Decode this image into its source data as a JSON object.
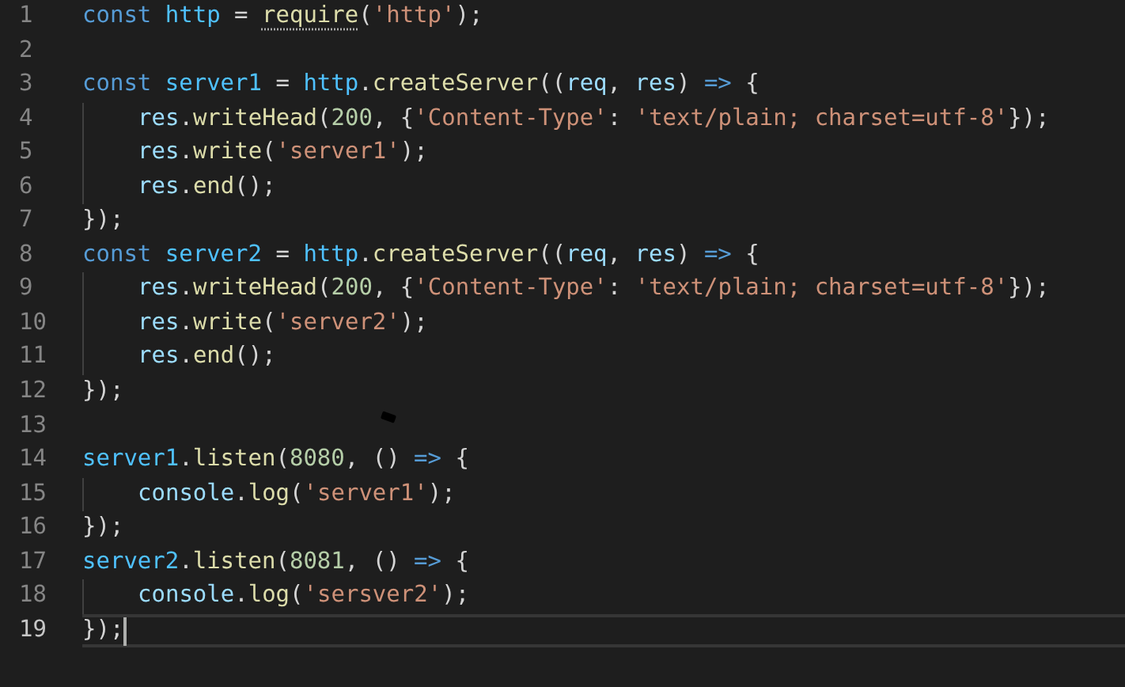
{
  "editor": {
    "lines": [
      {
        "number": "1",
        "current": false,
        "indented": false,
        "tokens": [
          {
            "kind": "keyword",
            "text": "const "
          },
          {
            "kind": "constant",
            "text": "http"
          },
          {
            "kind": "plain",
            "text": " = "
          },
          {
            "kind": "function",
            "text": "require",
            "hint": true
          },
          {
            "kind": "plain",
            "text": "("
          },
          {
            "kind": "string",
            "text": "'http'"
          },
          {
            "kind": "plain",
            "text": ");"
          }
        ]
      },
      {
        "number": "2",
        "current": false,
        "indented": false
      },
      {
        "number": "3",
        "current": false,
        "indented": false,
        "tokens": [
          {
            "kind": "keyword",
            "text": "const "
          },
          {
            "kind": "constant",
            "text": "server1"
          },
          {
            "kind": "plain",
            "text": " = "
          },
          {
            "kind": "constant",
            "text": "http"
          },
          {
            "kind": "plain",
            "text": "."
          },
          {
            "kind": "function",
            "text": "createServer"
          },
          {
            "kind": "plain",
            "text": "(("
          },
          {
            "kind": "variable",
            "text": "req"
          },
          {
            "kind": "plain",
            "text": ", "
          },
          {
            "kind": "variable",
            "text": "res"
          },
          {
            "kind": "plain",
            "text": ") "
          },
          {
            "kind": "keyword",
            "text": "=>"
          },
          {
            "kind": "plain",
            "text": " {"
          }
        ]
      },
      {
        "number": "4",
        "current": false,
        "indented": true,
        "tokens": [
          {
            "kind": "variable",
            "text": "res"
          },
          {
            "kind": "plain",
            "text": "."
          },
          {
            "kind": "function",
            "text": "writeHead"
          },
          {
            "kind": "plain",
            "text": "("
          },
          {
            "kind": "number",
            "text": "200"
          },
          {
            "kind": "plain",
            "text": ", {"
          },
          {
            "kind": "string",
            "text": "'Content-Type'"
          },
          {
            "kind": "plain",
            "text": ": "
          },
          {
            "kind": "string",
            "text": "'text/plain; charset=utf-8'"
          },
          {
            "kind": "plain",
            "text": "});"
          }
        ]
      },
      {
        "number": "5",
        "current": false,
        "indented": true,
        "tokens": [
          {
            "kind": "variable",
            "text": "res"
          },
          {
            "kind": "plain",
            "text": "."
          },
          {
            "kind": "function",
            "text": "write"
          },
          {
            "kind": "plain",
            "text": "("
          },
          {
            "kind": "string",
            "text": "'server1'"
          },
          {
            "kind": "plain",
            "text": ");"
          }
        ]
      },
      {
        "number": "6",
        "current": false,
        "indented": true,
        "tokens": [
          {
            "kind": "variable",
            "text": "res"
          },
          {
            "kind": "plain",
            "text": "."
          },
          {
            "kind": "function",
            "text": "end"
          },
          {
            "kind": "plain",
            "text": "();"
          }
        ]
      },
      {
        "number": "7",
        "current": false,
        "indented": false,
        "tokens": [
          {
            "kind": "plain",
            "text": "});"
          }
        ]
      },
      {
        "number": "8",
        "current": false,
        "indented": false,
        "tokens": [
          {
            "kind": "keyword",
            "text": "const "
          },
          {
            "kind": "constant",
            "text": "server2"
          },
          {
            "kind": "plain",
            "text": " = "
          },
          {
            "kind": "constant",
            "text": "http"
          },
          {
            "kind": "plain",
            "text": "."
          },
          {
            "kind": "function",
            "text": "createServer"
          },
          {
            "kind": "plain",
            "text": "(("
          },
          {
            "kind": "variable",
            "text": "req"
          },
          {
            "kind": "plain",
            "text": ", "
          },
          {
            "kind": "variable",
            "text": "res"
          },
          {
            "kind": "plain",
            "text": ") "
          },
          {
            "kind": "keyword",
            "text": "=>"
          },
          {
            "kind": "plain",
            "text": " {"
          }
        ]
      },
      {
        "number": "9",
        "current": false,
        "indented": true,
        "tokens": [
          {
            "kind": "variable",
            "text": "res"
          },
          {
            "kind": "plain",
            "text": "."
          },
          {
            "kind": "function",
            "text": "writeHead"
          },
          {
            "kind": "plain",
            "text": "("
          },
          {
            "kind": "number",
            "text": "200"
          },
          {
            "kind": "plain",
            "text": ", {"
          },
          {
            "kind": "string",
            "text": "'Content-Type'"
          },
          {
            "kind": "plain",
            "text": ": "
          },
          {
            "kind": "string",
            "text": "'text/plain; charset=utf-8'"
          },
          {
            "kind": "plain",
            "text": "});"
          }
        ]
      },
      {
        "number": "10",
        "current": false,
        "indented": true,
        "tokens": [
          {
            "kind": "variable",
            "text": "res"
          },
          {
            "kind": "plain",
            "text": "."
          },
          {
            "kind": "function",
            "text": "write"
          },
          {
            "kind": "plain",
            "text": "("
          },
          {
            "kind": "string",
            "text": "'server2'"
          },
          {
            "kind": "plain",
            "text": ");"
          }
        ]
      },
      {
        "number": "11",
        "current": false,
        "indented": true,
        "tokens": [
          {
            "kind": "variable",
            "text": "res"
          },
          {
            "kind": "plain",
            "text": "."
          },
          {
            "kind": "function",
            "text": "end"
          },
          {
            "kind": "plain",
            "text": "();"
          }
        ]
      },
      {
        "number": "12",
        "current": false,
        "indented": false,
        "tokens": [
          {
            "kind": "plain",
            "text": "});"
          }
        ]
      },
      {
        "number": "13",
        "current": false,
        "indented": false
      },
      {
        "number": "14",
        "current": false,
        "indented": false,
        "tokens": [
          {
            "kind": "constant",
            "text": "server1"
          },
          {
            "kind": "plain",
            "text": "."
          },
          {
            "kind": "function",
            "text": "listen"
          },
          {
            "kind": "plain",
            "text": "("
          },
          {
            "kind": "number",
            "text": "8080"
          },
          {
            "kind": "plain",
            "text": ", () "
          },
          {
            "kind": "keyword",
            "text": "=>"
          },
          {
            "kind": "plain",
            "text": " {"
          }
        ]
      },
      {
        "number": "15",
        "current": false,
        "indented": true,
        "tokens": [
          {
            "kind": "variable",
            "text": "console"
          },
          {
            "kind": "plain",
            "text": "."
          },
          {
            "kind": "function",
            "text": "log"
          },
          {
            "kind": "plain",
            "text": "("
          },
          {
            "kind": "string",
            "text": "'server1'"
          },
          {
            "kind": "plain",
            "text": ");"
          }
        ]
      },
      {
        "number": "16",
        "current": false,
        "indented": false,
        "tokens": [
          {
            "kind": "plain",
            "text": "});"
          }
        ]
      },
      {
        "number": "17",
        "current": false,
        "indented": false,
        "tokens": [
          {
            "kind": "constant",
            "text": "server2"
          },
          {
            "kind": "plain",
            "text": "."
          },
          {
            "kind": "function",
            "text": "listen"
          },
          {
            "kind": "plain",
            "text": "("
          },
          {
            "kind": "number",
            "text": "8081"
          },
          {
            "kind": "plain",
            "text": ", () "
          },
          {
            "kind": "keyword",
            "text": "=>"
          },
          {
            "kind": "plain",
            "text": " {"
          }
        ]
      },
      {
        "number": "18",
        "current": false,
        "indented": true,
        "tokens": [
          {
            "kind": "variable",
            "text": "console"
          },
          {
            "kind": "plain",
            "text": "."
          },
          {
            "kind": "function",
            "text": "log"
          },
          {
            "kind": "plain",
            "text": "("
          },
          {
            "kind": "string",
            "text": "'sersver2'"
          },
          {
            "kind": "plain",
            "text": ");"
          }
        ]
      },
      {
        "number": "19",
        "current": true,
        "indented": false,
        "tokens": [
          {
            "kind": "plain",
            "text": "});"
          }
        ]
      }
    ]
  }
}
